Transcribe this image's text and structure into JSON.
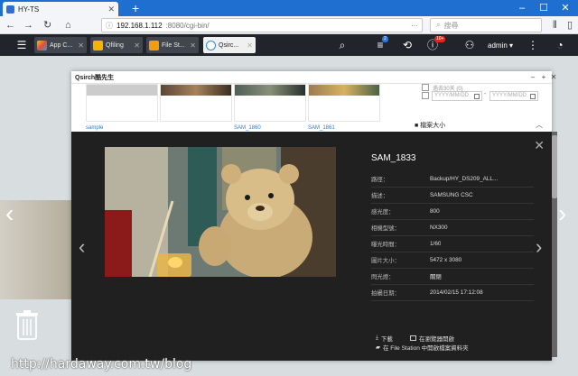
{
  "browser": {
    "tab_title": "HY-TS",
    "url_host": "192.168.1.112",
    "url_path": ":8080/cgi-bin/",
    "search_placeholder": "搜尋"
  },
  "qts": {
    "tabs": [
      {
        "label": "App C..."
      },
      {
        "label": "Qfiling"
      },
      {
        "label": "File St..."
      },
      {
        "label": "Qsirc..."
      }
    ],
    "user": "admin",
    "badges": {
      "tasks": "2",
      "notifications": "10+"
    }
  },
  "window": {
    "title": "Qsirch酷先生",
    "thumbnails": [
      {
        "caption": "sample"
      },
      {
        "caption": ""
      },
      {
        "caption": "SAM_1860"
      },
      {
        "caption": "SAM_1861"
      }
    ],
    "date_placeholder": "YYYY/MM/DD",
    "date_separator": "-",
    "partial_option": "過去30天 (0)",
    "section_label": "■ 檔案大小"
  },
  "viewer": {
    "title": "SAM_1833",
    "rows": [
      {
        "key": "路徑：",
        "value": "Backup/HY_DS209_ALL..."
      },
      {
        "key": "描述：",
        "value": "SAMSUNG CSC"
      },
      {
        "key": "感光度：",
        "value": "800"
      },
      {
        "key": "相機型號：",
        "value": "NX300"
      },
      {
        "key": "曝光時間：",
        "value": "1/60"
      },
      {
        "key": "圖片大小：",
        "value": "5472 x 3080"
      },
      {
        "key": "閃光燈：",
        "value": "關閉"
      },
      {
        "key": "拍攝日期：",
        "value": "2014/02/15 17:12:08"
      }
    ],
    "download": "下載",
    "open_browser": "在瀏覽器開啟",
    "open_in_filestation": "在 File Station 中開啟檔案資料夾"
  },
  "watermark": "http://hardaway.com.tw/blog"
}
